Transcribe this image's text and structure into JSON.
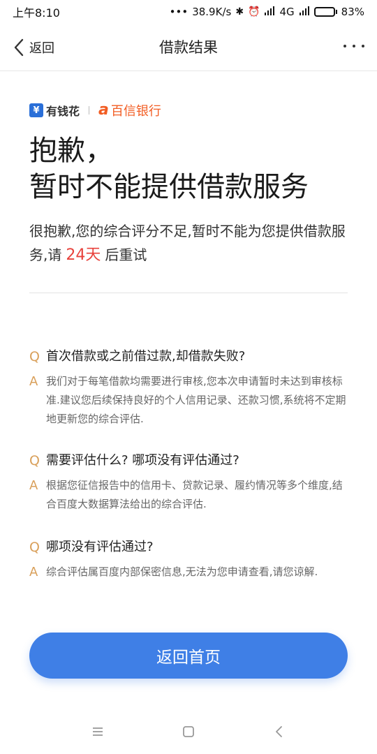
{
  "status_bar": {
    "time": "上午8:10",
    "dots": "•••",
    "net_speed": "38.9K/s",
    "network": "4G",
    "battery_percent": "83%",
    "battery_level": 0.83
  },
  "nav": {
    "back_label": "返回",
    "title": "借款结果"
  },
  "logos": {
    "youqianhua_mark": "¥",
    "youqianhua": "有钱花",
    "baixin_mark": "a",
    "baixin": "百信银行"
  },
  "headline": {
    "line1": "抱歉，",
    "line2": "暂时不能提供借款服务"
  },
  "message": {
    "part1": "很抱歉,您的综合评分不足,暂时不能为您提供借款服务,请",
    "days": "24天",
    "part2": "后重试"
  },
  "faq": {
    "q_mark": "Q",
    "a_mark": "A",
    "items": [
      {
        "q": "首次借款或之前借过款,却借款失败?",
        "a": "我们对于每笔借款均需要进行审核,您本次申请暂时未达到审核标准.建议您后续保持良好的个人信用记录、还款习惯,系统将不定期地更新您的综合评估."
      },
      {
        "q": "需要评估什么? 哪项没有评估通过?",
        "a": "根据您征信报告中的信用卡、贷款记录、履约情况等多个维度,结合百度大数据算法给出的综合评估."
      },
      {
        "q": "哪项没有评估通过?",
        "a": "综合评估属百度内部保密信息,无法为您申请查看,请您谅解."
      }
    ]
  },
  "button": {
    "home_label": "返回首页"
  },
  "colors": {
    "primary": "#3f7fe6",
    "accent_red": "#e8423c",
    "qa_mark": "#d9a05b",
    "baixin_orange": "#f25d23"
  }
}
